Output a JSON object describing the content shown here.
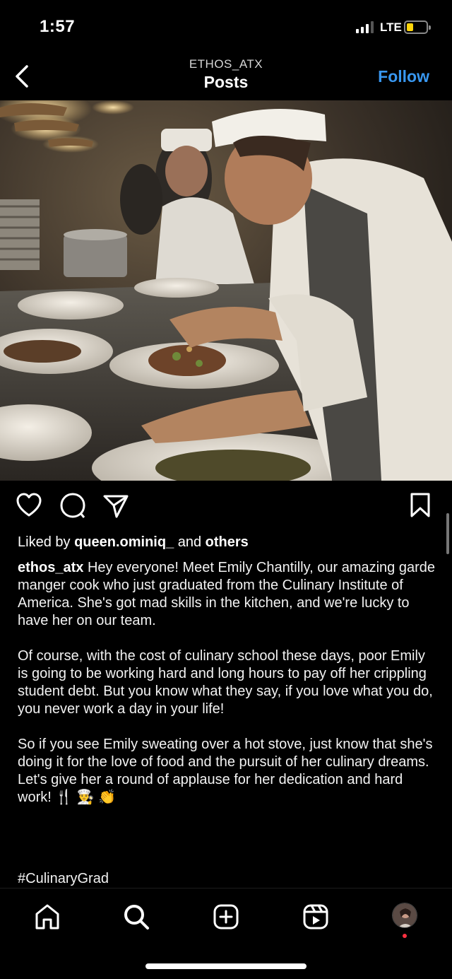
{
  "status_bar": {
    "time": "1:57",
    "network": "LTE",
    "battery_color": "#ffd60a"
  },
  "header": {
    "username": "ETHOS_ATX",
    "title": "Posts",
    "follow_label": "Follow",
    "accent": "#3897f0"
  },
  "post": {
    "liked_by_prefix": "Liked by ",
    "liked_by_user": "queen.ominiq_",
    "liked_by_mid": " and ",
    "liked_by_others": "others",
    "caption_user": "ethos_atx",
    "caption_p1": "Hey everyone! Meet Emily Chantilly, our amazing garde manger cook who just graduated from the Culinary Institute of America. She's got mad skills in the kitchen, and we're lucky to have her on our team.",
    "caption_p2": "Of course, with the cost of culinary school these days, poor Emily is going to be working hard and long hours to pay off her crippling student debt. But you know what they say, if you love what you do, you never work a day in your life!",
    "caption_p3": "So if you see Emily sweating over a hot stove, just know that she's doing it for the love of food and the pursuit of her culinary dreams. Let's give her a round of applause for her dedication and hard work! 🍴 👨‍🍳 👏",
    "hashtag": "#CulinaryGrad"
  },
  "icons": {
    "back": "chevron-left-icon",
    "like": "heart-icon",
    "comment": "comment-bubble-icon",
    "share": "paper-plane-icon",
    "save": "bookmark-icon",
    "tabs": [
      "home-icon",
      "search-icon",
      "new-post-icon",
      "reels-icon",
      "profile-avatar"
    ]
  }
}
